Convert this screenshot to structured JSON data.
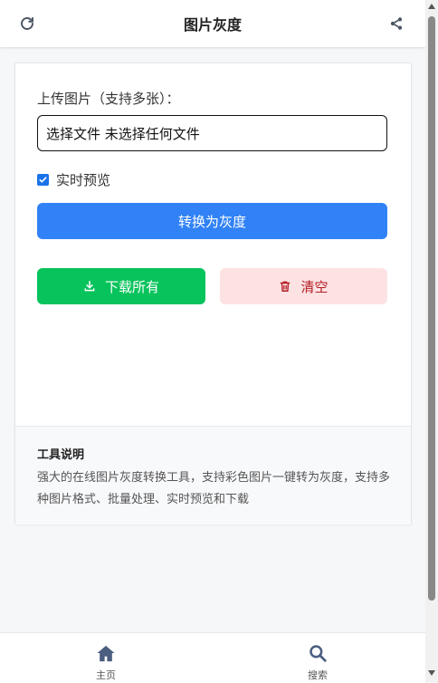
{
  "header": {
    "title": "图片灰度",
    "refresh_icon": "refresh-icon",
    "share_icon": "share-icon"
  },
  "upload": {
    "label": "上传图片（支持多张）：",
    "file_input_text": "选择文件 未选择任何文件"
  },
  "preview": {
    "checkbox_label": "实时预览",
    "checked": true
  },
  "buttons": {
    "convert": "转换为灰度",
    "download": "下载所有",
    "clear": "清空"
  },
  "info": {
    "title": "工具说明",
    "text": "强大的在线图片灰度转换工具，支持彩色图片一键转为灰度，支持多种图片格式、批量处理、实时预览和下载"
  },
  "nav": {
    "home": "主页",
    "search": "搜索"
  },
  "colors": {
    "convert": "#3182f6",
    "download": "#07c35b",
    "clear_bg": "#fde2e3",
    "clear_text": "#b21c24"
  }
}
